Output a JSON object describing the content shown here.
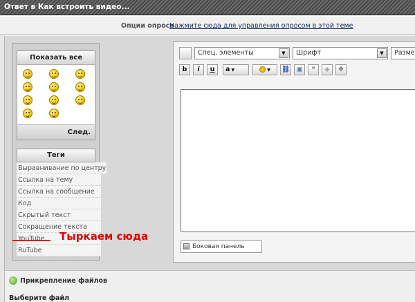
{
  "window": {
    "title": "Ответ в Как встроить видео..."
  },
  "poll": {
    "label": "Опции опроса",
    "link": "Нажмите сюда для управления опросом в этой теме"
  },
  "smileys": {
    "header": "Показать все",
    "next": "След.",
    "icons": [
      "smile-icon",
      "wink-icon",
      "grin-icon",
      "surprised-icon",
      "blush-icon",
      "laugh-icon",
      "biggrin-icon",
      "cool-icon",
      "tongue-icon",
      "happy-icon",
      "cheerful-icon"
    ]
  },
  "tags": {
    "header": "Теги",
    "items": [
      "Выравнивание по центру",
      "Ссылка на тему",
      "Ссылка на сообщение",
      "Код",
      "Скрытый текст",
      "Сокращение текста",
      "YouTube",
      "RuTube"
    ]
  },
  "annotation": {
    "text": "Тыркаем сюда",
    "color": "#e60000"
  },
  "editor": {
    "special_select": "Спец. элементы",
    "font_select": "Шрифт",
    "size_select": "Размер",
    "bold": "b",
    "italic": "i",
    "underline": "u",
    "size_btn": "a",
    "side_panel": "Боковая панель"
  },
  "attachments": {
    "header": "Прикрепление файлов",
    "sub": "Выберите файл"
  }
}
